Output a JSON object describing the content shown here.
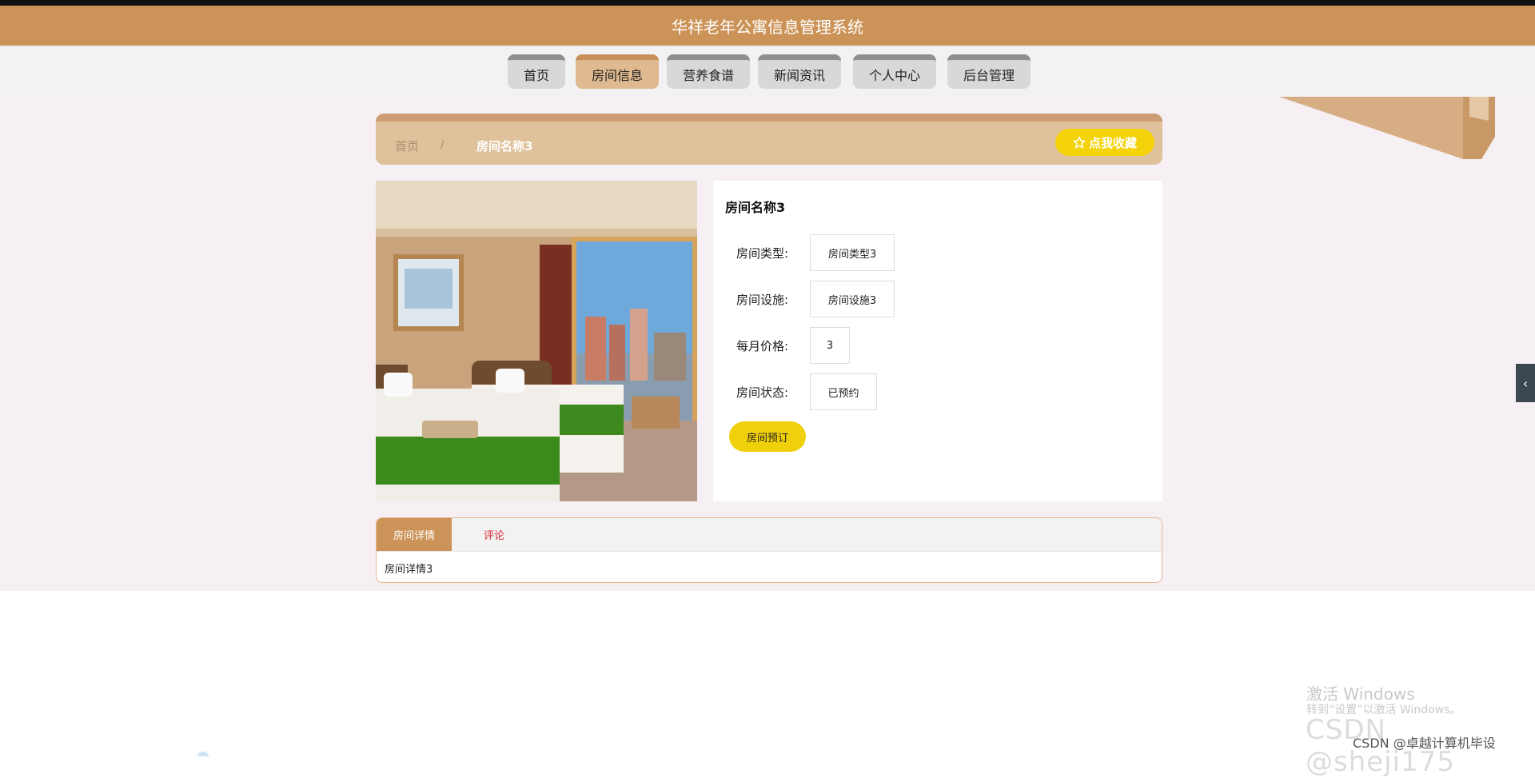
{
  "app": {
    "title": "华祥老年公寓信息管理系统"
  },
  "nav": {
    "items": [
      {
        "label": "首页",
        "active": false
      },
      {
        "label": "房间信息",
        "active": true
      },
      {
        "label": "营养食谱",
        "active": false
      },
      {
        "label": "新闻资讯",
        "active": false
      },
      {
        "label": "个人中心",
        "active": false
      },
      {
        "label": "后台管理",
        "active": false
      }
    ]
  },
  "breadcrumb": {
    "home": "首页",
    "separator": "/",
    "current": "房间名称3"
  },
  "favorite_button": {
    "icon": "star-outline-icon",
    "label": "点我收藏"
  },
  "room": {
    "name": "房间名称3",
    "fields": [
      {
        "label": "房间类型:",
        "value": "房间类型3"
      },
      {
        "label": "房间设施:",
        "value": "房间设施3"
      },
      {
        "label": "每月价格:",
        "value": "3"
      },
      {
        "label": "房间状态:",
        "value": "已预约"
      }
    ],
    "book_button": "房间预订"
  },
  "tabs": {
    "items": [
      {
        "label": "房间详情",
        "active": true
      },
      {
        "label": "评论",
        "active": false
      }
    ],
    "content": "房间详情3"
  },
  "watermark": {
    "line1": "激活 Windows",
    "line2": "转到“设置”以激活 Windows。",
    "csdn_big": "CSDN @sheji175",
    "csdn_small": "CSDN @卓越计算机毕设"
  },
  "colors": {
    "header": "#cc9358",
    "nav_active": "#dfb98f",
    "accent_yellow": "#f4d30b",
    "comment_red": "#d7262e"
  }
}
